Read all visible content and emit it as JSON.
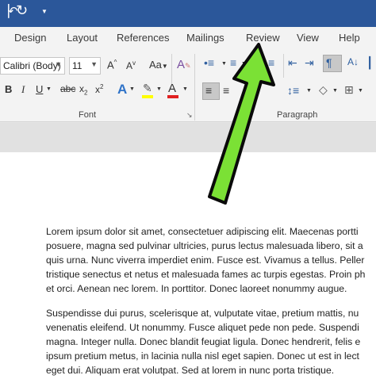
{
  "tabs": [
    "Design",
    "Layout",
    "References",
    "Mailings",
    "Review",
    "View",
    "Help"
  ],
  "font": {
    "name": "Calibri (Body)",
    "size": "11",
    "group_label": "Font"
  },
  "paragraph": {
    "group_label": "Paragraph"
  },
  "colors": {
    "title_bar": "#2b579a",
    "highlight": "#ffff00",
    "font_color": "#e02020",
    "arrow_fill": "#7be135",
    "arrow_stroke": "#0a0a0a"
  },
  "document": {
    "paragraphs": [
      [
        "Lorem ipsum dolor sit amet, consectetuer adipiscing elit. Maecenas portti",
        "posuere, magna sed pulvinar ultricies, purus lectus malesuada libero, sit a",
        "quis urna. Nunc viverra imperdiet enim. Fusce est. Vivamus a tellus. Peller",
        "tristique senectus et netus et malesuada fames ac turpis egestas. Proin ph",
        "et orci. Aenean nec lorem. In porttitor. Donec laoreet nonummy augue."
      ],
      [
        "Suspendisse dui purus, scelerisque at, vulputate vitae, pretium mattis, nu",
        "venenatis eleifend. Ut nonummy. Fusce aliquet pede non pede. Suspendi",
        "magna. Integer nulla. Donec blandit feugiat ligula. Donec hendrerit, felis e",
        "ipsum pretium metus, in lacinia nulla nisl eget sapien. Donec ut est in lect",
        "eget dui. Aliquam erat volutpat. Sed at lorem in nunc porta tristique."
      ]
    ]
  }
}
